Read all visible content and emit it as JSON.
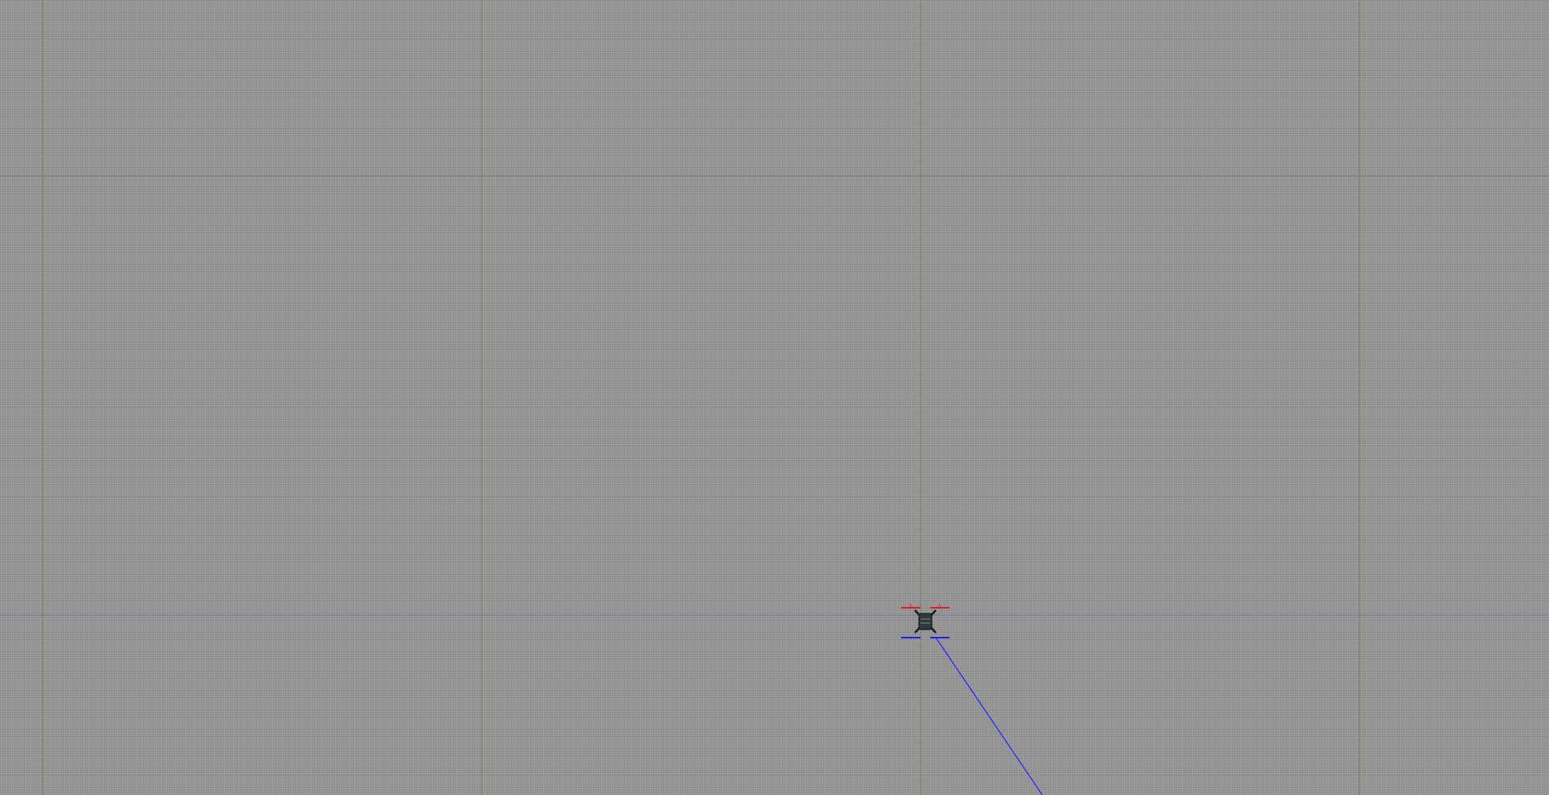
{
  "scene": {
    "background_color": "#9a9a9a",
    "major_grid_color": "#707a5c",
    "axis_line_color": "#7a7aa8",
    "trajectory_color": "#2a2aff"
  },
  "vehicle": {
    "type": "quadcopter",
    "body_color": "#2e3a3a",
    "front_rotor_color": "#e02020",
    "rear_rotor_color": "#2020e0",
    "icon": "quadcopter-icon"
  }
}
